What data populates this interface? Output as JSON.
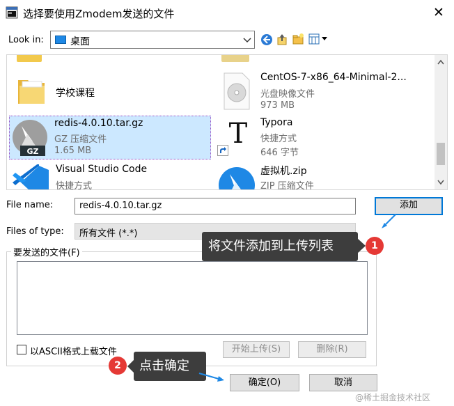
{
  "window": {
    "title": "选择要使用Zmodem发送的文件",
    "close_glyph": "✕"
  },
  "toolbar": {
    "look_in_label": "Look in:",
    "look_in_value": "桌面"
  },
  "files": [
    {
      "name": "学校课程",
      "sub1": "",
      "sub2": "",
      "icon": "folder-icon"
    },
    {
      "name": "CentOS-7-x86_64-Minimal-2...",
      "sub1": "光盘映像文件",
      "sub2": "973 MB",
      "icon": "disc-image-icon"
    },
    {
      "name": "redis-4.0.10.tar.gz",
      "sub1": "GZ 压缩文件",
      "sub2": "1.65 MB",
      "icon": "gz-archive-icon",
      "selected": true
    },
    {
      "name": "Typora",
      "sub1": "快捷方式",
      "sub2": "646 字节",
      "icon": "typora-icon"
    },
    {
      "name": "Visual Studio Code",
      "sub1": "快捷方式",
      "sub2": "",
      "icon": "vscode-icon"
    },
    {
      "name": "虚拟机.zip",
      "sub1": "ZIP 压缩文件",
      "sub2": "",
      "icon": "zip-archive-icon"
    }
  ],
  "form": {
    "file_name_label": "File name:",
    "file_name_value": "redis-4.0.10.tar.gz",
    "files_of_type_label": "Files of type:",
    "files_of_type_value": "所有文件 (*.*)",
    "add_button": "添加"
  },
  "send_group": {
    "label": "要发送的文件(F)",
    "ascii_checkbox_label": "以ASCII格式上载文件",
    "start_upload_button": "开始上传(S)",
    "delete_button": "删除(R)"
  },
  "dialog_buttons": {
    "ok": "确定(O)",
    "cancel": "取消"
  },
  "annotations": {
    "step1_badge": "1",
    "step1_text": "将文件添加到上传列表",
    "step2_badge": "2",
    "step2_text": "点击确定"
  },
  "watermark": "@稀土掘金技术社区",
  "colors": {
    "selection_bg": "#cce8ff",
    "selection_border": "#9b4fc4",
    "callout_bg": "#3d3d3d",
    "badge_red": "#e53935",
    "arrow_blue": "#1e88e5"
  }
}
